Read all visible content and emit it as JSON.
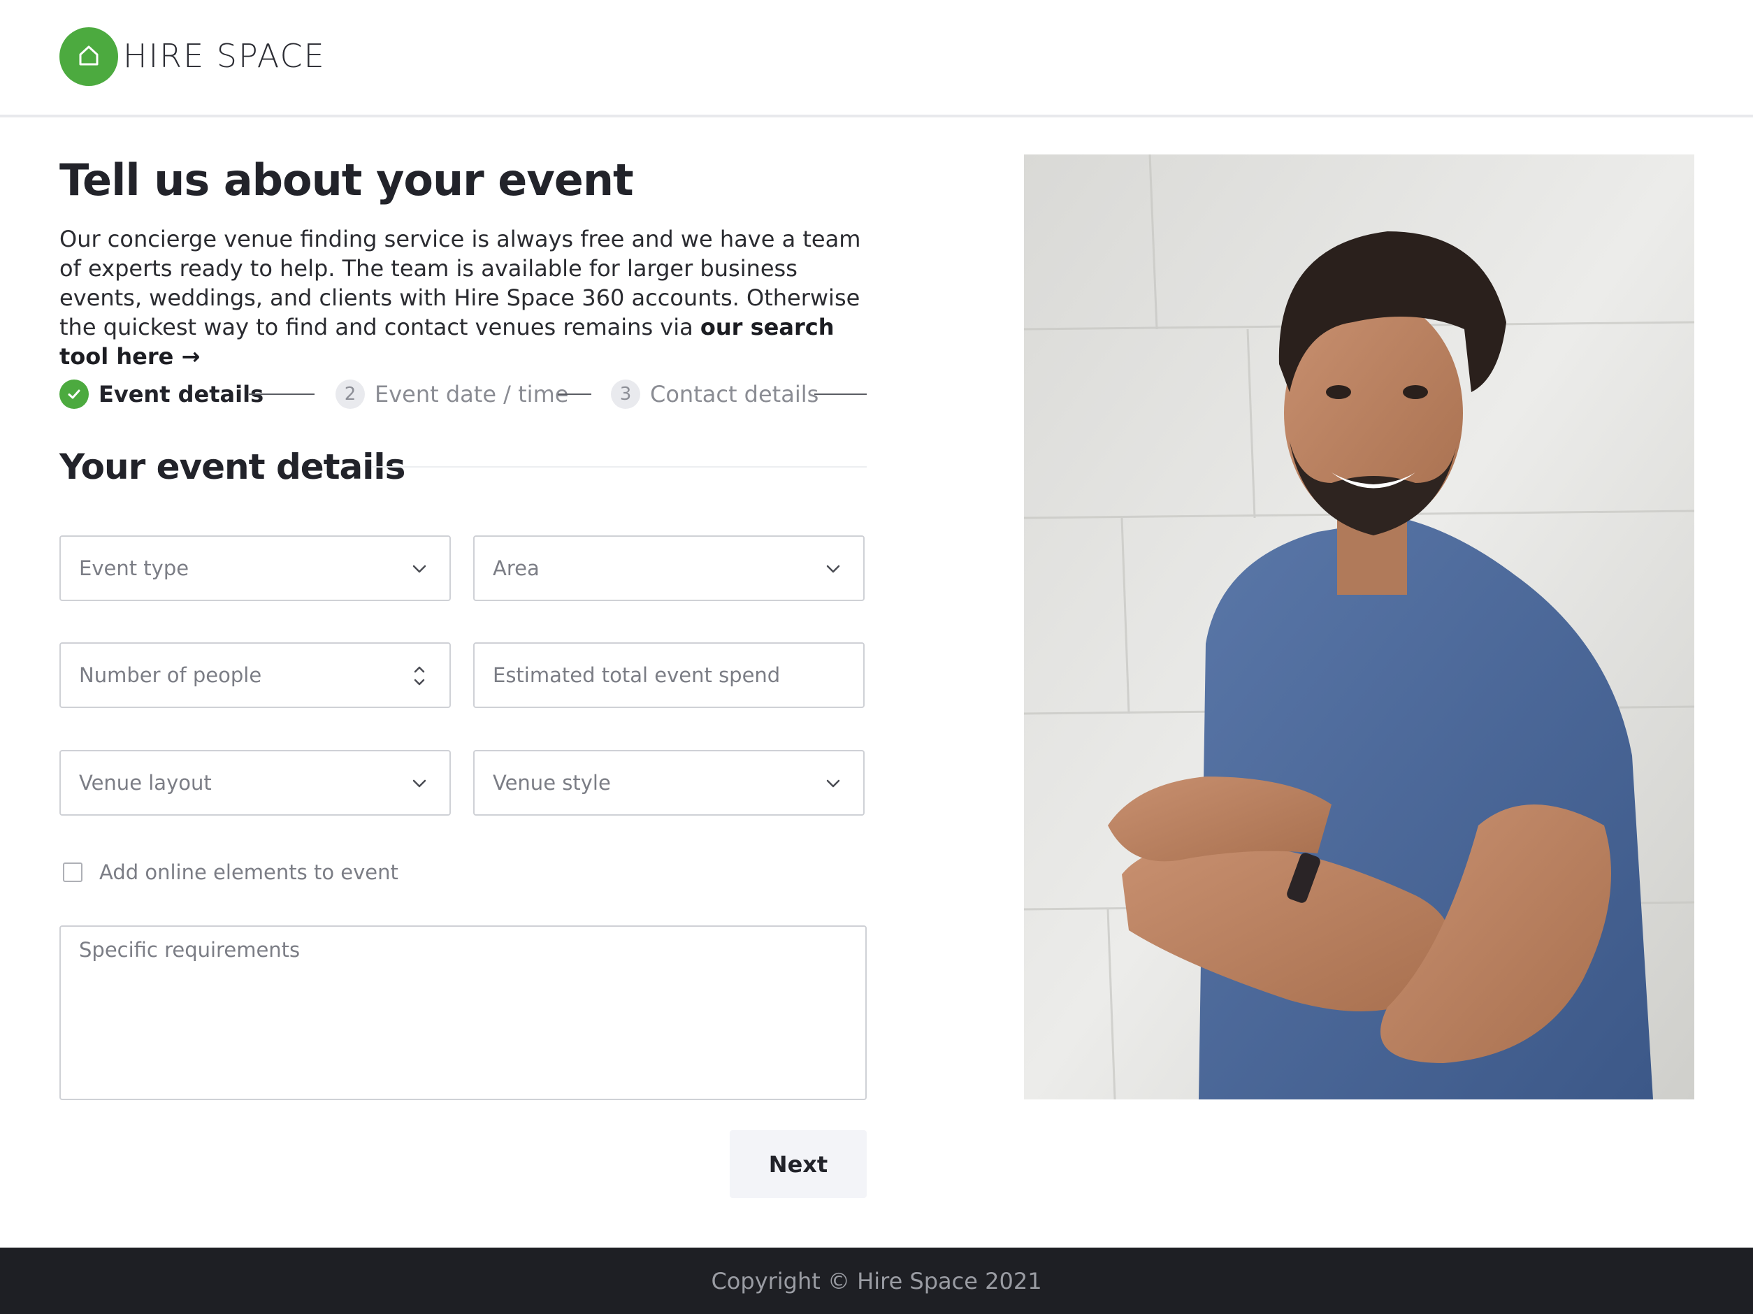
{
  "header": {
    "logo_text": "HIRE SPACE",
    "logo_icon": "house-icon",
    "brand_color": "#4caa3f"
  },
  "intro": {
    "title": "Tell us about your event",
    "paragraph": "Our concierge venue finding service is always free and we have a team of experts ready to help. The team is available for larger business events, weddings, and clients with Hire Space 360 accounts. Otherwise the quickest way to find and contact venues remains via ",
    "search_link": "our search tool here →"
  },
  "steps": [
    {
      "number": "1",
      "label": "Event details",
      "status": "complete"
    },
    {
      "number": "2",
      "label": "Event date / time",
      "status": "upcoming"
    },
    {
      "number": "3",
      "label": "Contact details",
      "status": "upcoming"
    }
  ],
  "form": {
    "section_title": "Your event details",
    "event_type": "Event type",
    "area": "Area",
    "number_of_people": "Number of people",
    "estimated_spend": "Estimated total event spend",
    "venue_layout": "Venue layout",
    "venue_style": "Venue style",
    "online_elements": "Add online elements to event",
    "specific_requirements": "Specific requirements",
    "next_label": "Next"
  },
  "footer": {
    "copyright": "Copyright © Hire Space 2021"
  }
}
